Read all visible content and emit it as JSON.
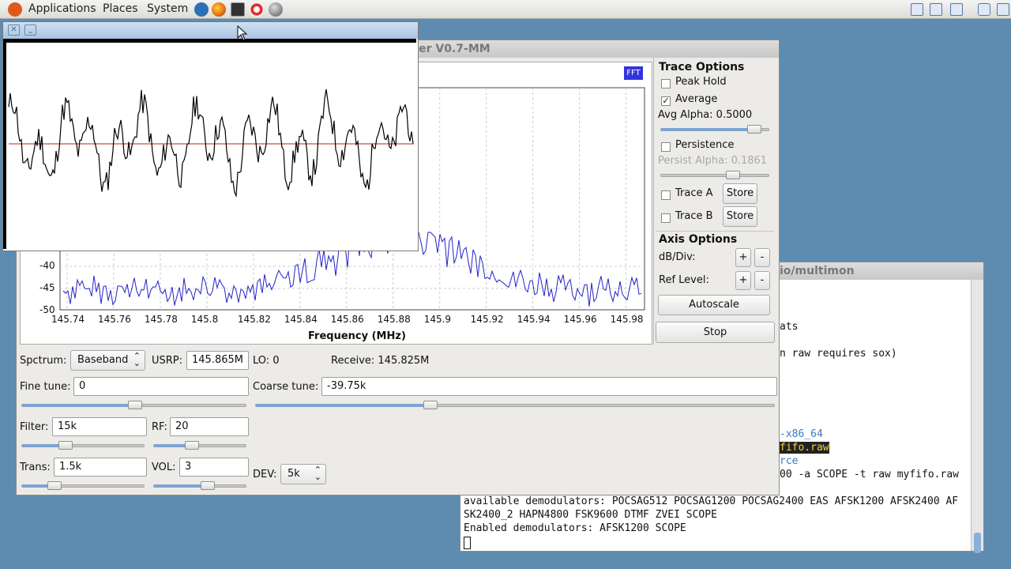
{
  "panel": {
    "menus": [
      "Applications",
      "Places",
      "System"
    ]
  },
  "main_window": {
    "title": "ver V0.7-MM",
    "fft_badge": "FFT",
    "spectrum": {
      "y_ticks": [
        "-40",
        "-45",
        "-50"
      ],
      "x_ticks": [
        "145.74",
        "145.76",
        "145.78",
        "145.8",
        "145.82",
        "145.84",
        "145.86",
        "145.88",
        "145.9",
        "145.92",
        "145.94",
        "145.96",
        "145.98"
      ],
      "x_label": "Frequency (MHz)"
    },
    "trace_options": {
      "heading": "Trace Options",
      "peak_hold": "Peak Hold",
      "average": "Average",
      "avg_alpha": "Avg Alpha: 0.5000",
      "persistence": "Persistence",
      "persist_alpha": "Persist Alpha: 0.1861",
      "trace_a": "Trace A",
      "trace_b": "Trace B",
      "store": "Store",
      "peak_hold_checked": false,
      "average_checked": true,
      "persistence_checked": false,
      "trace_a_checked": false,
      "trace_b_checked": false,
      "avg_alpha_level": 0.5,
      "persist_alpha_level": 0.1861
    },
    "axis_options": {
      "heading": "Axis Options",
      "db_div": "dB/Div:",
      "ref_level": "Ref Level:",
      "plus": "+",
      "minus": "-",
      "autoscale": "Autoscale",
      "stop": "Stop"
    },
    "controls": {
      "spectrum_label": "Spctrum:",
      "spectrum_value": "Baseband",
      "usrp_label": "USRP:",
      "usrp_value": "145.865M",
      "lo_label": "LO: 0",
      "receive_label": "Receive: 145.825M",
      "fine_tune_label": "Fine tune:",
      "fine_tune_value": "0",
      "coarse_tune_label": "Coarse tune:",
      "coarse_tune_value": "-39.75k",
      "filter_label": "Filter:",
      "filter_value": "15k",
      "rf_label": "RF:",
      "rf_value": "20",
      "trans_label": "Trans:",
      "trans_value": "1.5k",
      "vol_label": "VOL:",
      "vol_value": "3",
      "dev_label": "DEV:",
      "dev_value": "5k"
    }
  },
  "terminal": {
    "title": "io/multimon",
    "lines": [
      "ats",
      "n raw requires sox)",
      "-x86_64",
      "fifo.raw",
      "rce",
      "00 -a SCOPE -t raw myfifo.raw",
      "available demodulators: POCSAG512 POCSAG1200 POCSAG2400 EAS AFSK1200 AFSK2400 AF",
      "SK2400_2 HAPN4800 FSK9600 DTMF ZVEI SCOPE",
      "Enabled demodulators: AFSK1200 SCOPE"
    ]
  },
  "colors": {
    "desktop": "#5d8cb0",
    "spectrum_trace": "#2323c8",
    "scope_trace": "#000000",
    "scope_baseline": "#b42020",
    "fft_badge": "#3333dd"
  }
}
